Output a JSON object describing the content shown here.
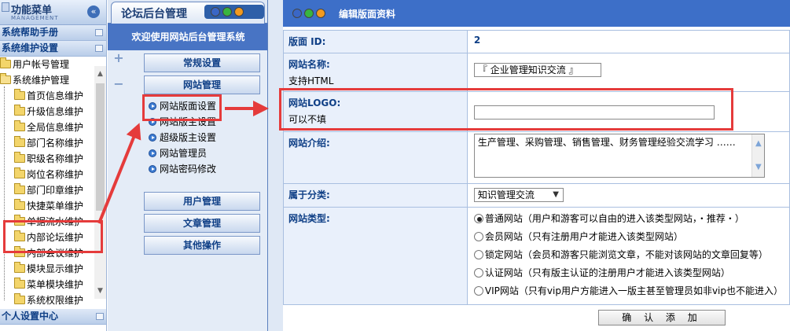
{
  "left_menu": {
    "title": "功能菜单",
    "subtitle": "MANAGEMENT",
    "groups": [
      "系统帮助手册",
      "系统维护设置"
    ],
    "tree": [
      {
        "label": "用户帐号管理",
        "indent": 0
      },
      {
        "label": "系统维护管理",
        "indent": 0
      },
      {
        "label": "首页信息维护",
        "indent": 1
      },
      {
        "label": "升级信息维护",
        "indent": 1
      },
      {
        "label": "全局信息维护",
        "indent": 1
      },
      {
        "label": "部门名称维护",
        "indent": 1
      },
      {
        "label": "职级名称维护",
        "indent": 1
      },
      {
        "label": "岗位名称维护",
        "indent": 1
      },
      {
        "label": "部门印章维护",
        "indent": 1
      },
      {
        "label": "快捷菜单维护",
        "indent": 1
      },
      {
        "label": "单据流水维护",
        "indent": 1
      },
      {
        "label": "内部论坛维护",
        "indent": 1
      },
      {
        "label": "内部会议维护",
        "indent": 1
      },
      {
        "label": "模块显示维护",
        "indent": 1
      },
      {
        "label": "菜单模块维护",
        "indent": 1
      },
      {
        "label": "系统权限维护",
        "indent": 1
      }
    ],
    "personal_center": "个人设置中心"
  },
  "forum_panel": {
    "tab_title": "论坛后台管理",
    "welcome": "欢迎使用网站后台管理系统",
    "categories": [
      "常规设置",
      "网站管理",
      "用户管理",
      "文章管理",
      "其他操作"
    ],
    "site_links": [
      "网站版面设置",
      "网站版主设置",
      "超级版主设置",
      "网站管理员",
      "网站密码修改"
    ]
  },
  "edit_panel": {
    "title": "编辑版面资料",
    "board_id_label": "版面 ID:",
    "board_id_value": "2",
    "site_name_label": "网站名称:",
    "site_name_note": "支持HTML",
    "site_name_value": "『 企业管理知识交流 』",
    "logo_label": "网站LOGO:",
    "logo_note": "可以不填",
    "logo_value": "",
    "intro_label": "网站介绍:",
    "intro_value": "生产管理、采购管理、销售管理、财务管理经验交流学习 ……",
    "category_label": "属于分类:",
    "category_value": "知识管理交流",
    "type_label": "网站类型:",
    "type_options": [
      "普通网站（用户和游客可以自由的进入该类型网站，・推荐・）",
      "会员网站（只有注册用户才能进入该类型网站）",
      "锁定网站（会员和游客只能浏览文章，不能对该网站的文章回复等）",
      "认证网站（只有版主认证的注册用户才能进入该类型网站）",
      "VIP网站（只有vip用户方能进入一版主甚至管理员如非vip也不能进入）"
    ],
    "type_selected_index": 0,
    "submit_label": "确 认 添 加"
  },
  "colors": {
    "highlight": "#e53b3b",
    "header_blue": "#3d6fc8",
    "label_bg": "#e9f0fb"
  }
}
